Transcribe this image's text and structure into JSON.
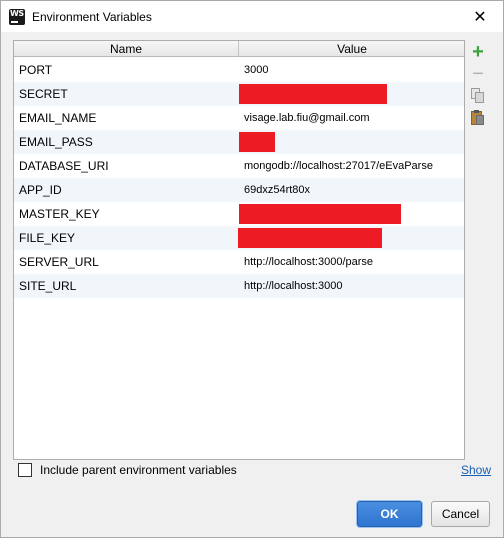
{
  "window": {
    "title": "Environment Variables",
    "icon": "webstorm-app-icon",
    "close_glyph": "✕",
    "app_icon_text": "WS"
  },
  "table": {
    "columns": [
      "Name",
      "Value"
    ],
    "rows": [
      {
        "name": "PORT",
        "value": "3000",
        "redacted": false
      },
      {
        "name": "SECRET",
        "value": "",
        "redacted": true
      },
      {
        "name": "EMAIL_NAME",
        "value": "visage.lab.fiu@gmail.com",
        "redacted": false
      },
      {
        "name": "EMAIL_PASS",
        "value": "",
        "redacted": true
      },
      {
        "name": "DATABASE_URI",
        "value": "mongodb://localhost:27017/eEvaParse",
        "redacted": false
      },
      {
        "name": "APP_ID",
        "value": "69dxz54rt80x",
        "redacted": false
      },
      {
        "name": "MASTER_KEY",
        "value": "",
        "redacted": true
      },
      {
        "name": "FILE_KEY",
        "value": "",
        "redacted": true
      },
      {
        "name": "SERVER_URL",
        "value": "http://localhost:3000/parse",
        "redacted": false
      },
      {
        "name": "SITE_URL",
        "value": "http://localhost:3000",
        "redacted": false
      }
    ]
  },
  "toolbar": {
    "add_glyph": "+",
    "remove_glyph": "−",
    "icons": [
      "add-icon",
      "remove-icon",
      "copy-icon",
      "paste-icon"
    ]
  },
  "include_parent": {
    "label": "Include parent environment variables",
    "checked": false
  },
  "show_link": "Show",
  "buttons": {
    "ok": "OK",
    "cancel": "Cancel"
  },
  "colors": {
    "redaction": "#ed1c24",
    "ok_button": "#2f74cf",
    "add_icon": "#3ea33e",
    "link": "#1a5fb4"
  }
}
